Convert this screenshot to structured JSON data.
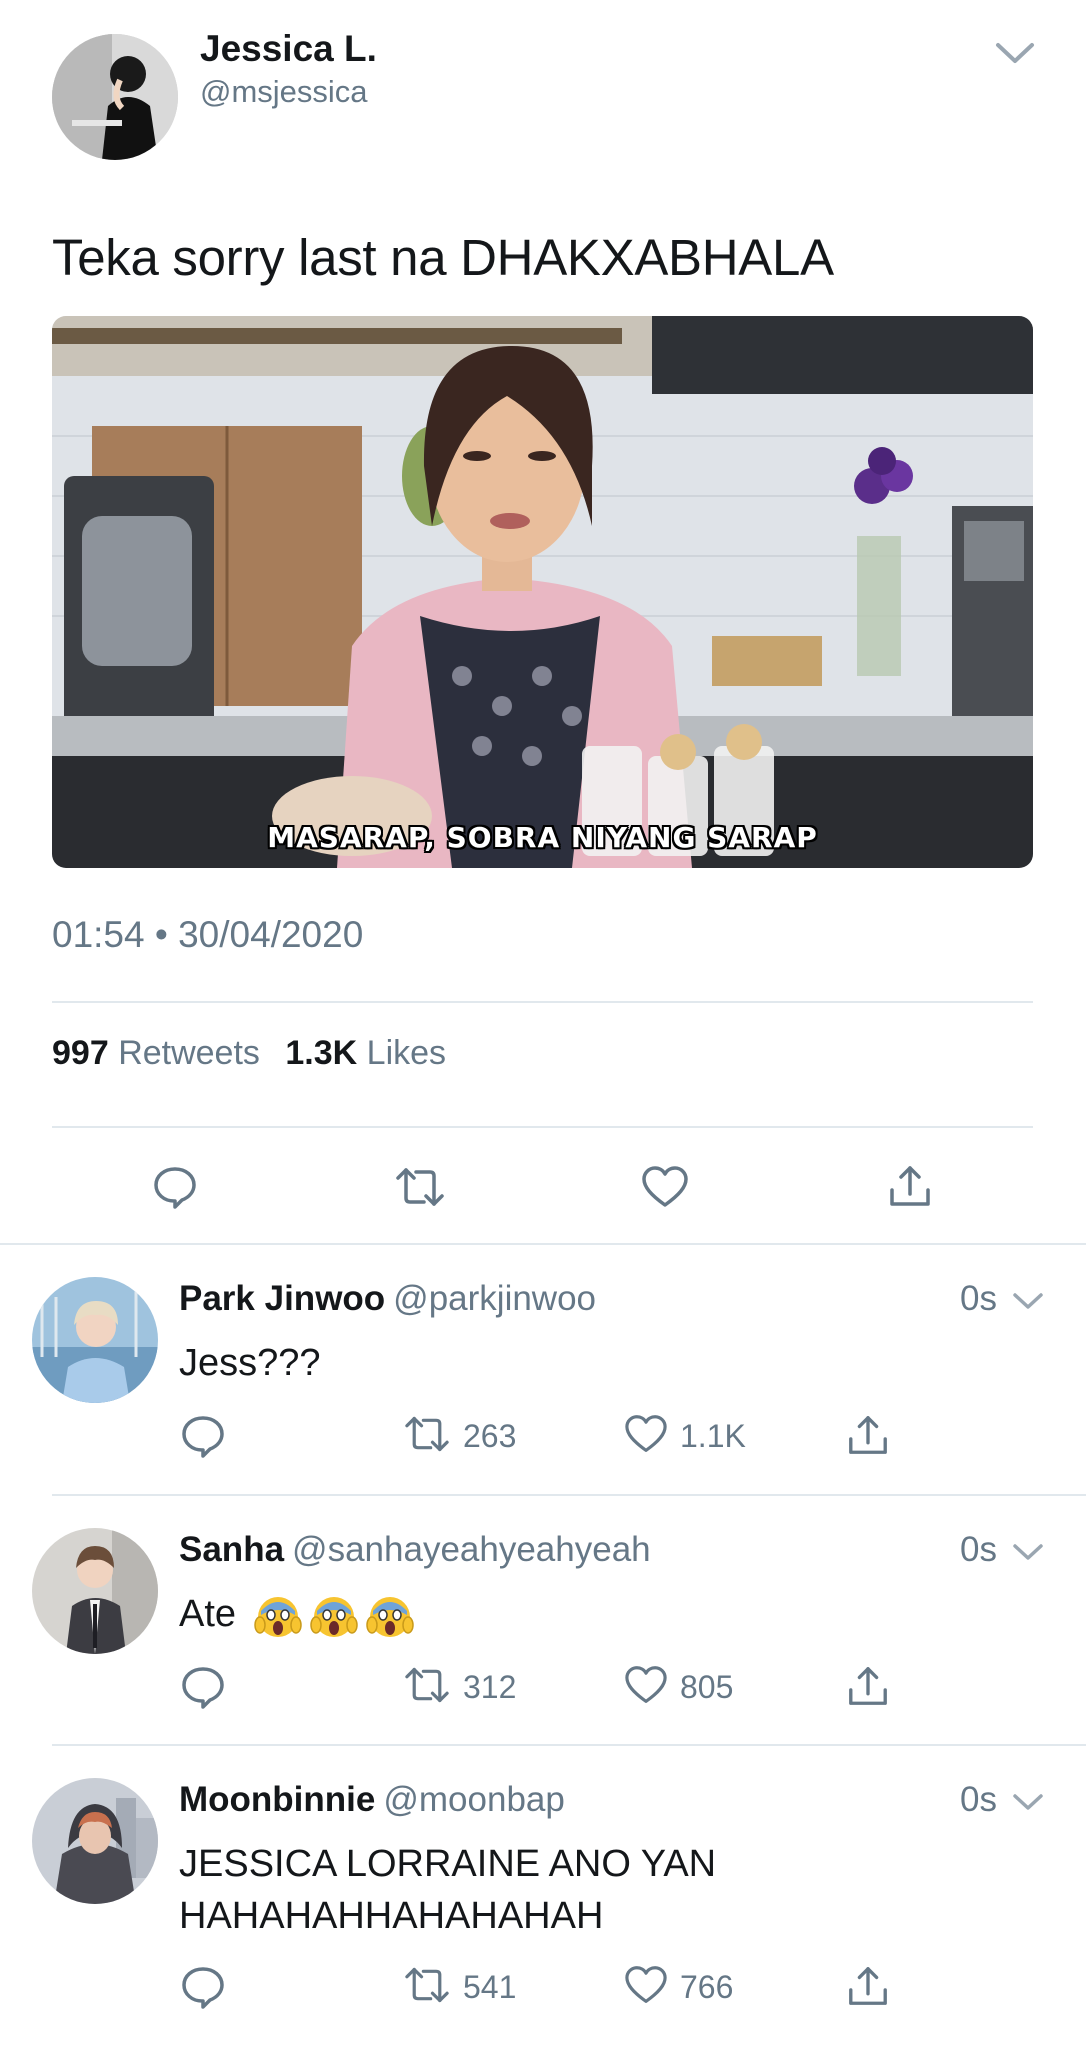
{
  "tweet": {
    "author_name": "Jessica L.",
    "author_handle": "@msjessica",
    "text": "Teka sorry last na DHAKXABHALA",
    "media_caption": "MASARAP, SOBRA NIYANG SARAP",
    "timestamp": "01:54 • 30/04/2020",
    "retweet_count": "997",
    "retweet_label": "Retweets",
    "like_count": "1.3K",
    "like_label": "Likes",
    "icons": [
      "reply-icon",
      "retweet-icon",
      "like-icon",
      "share-icon"
    ]
  },
  "replies": [
    {
      "name": "Park Jinwoo",
      "handle": "@parkjinwoo",
      "time": "0s",
      "text": "Jess???",
      "retweets": "263",
      "likes": "1.1K"
    },
    {
      "name": "Sanha",
      "handle": "@sanhayeahyeahyeah",
      "time": "0s",
      "text": "Ate",
      "emoji": "😱😱😱",
      "retweets": "312",
      "likes": "805"
    },
    {
      "name": "Moonbinnie",
      "handle": "@moonbap",
      "time": "0s",
      "text_line1": "JESSICA LORRAINE ANO YAN",
      "text_line2": "HAHAHAHHAHAHAHAH",
      "retweets": "541",
      "likes": "766"
    }
  ],
  "colors": {
    "text": "#14171a",
    "secondary": "#657786",
    "divider": "#e1e8ed"
  }
}
